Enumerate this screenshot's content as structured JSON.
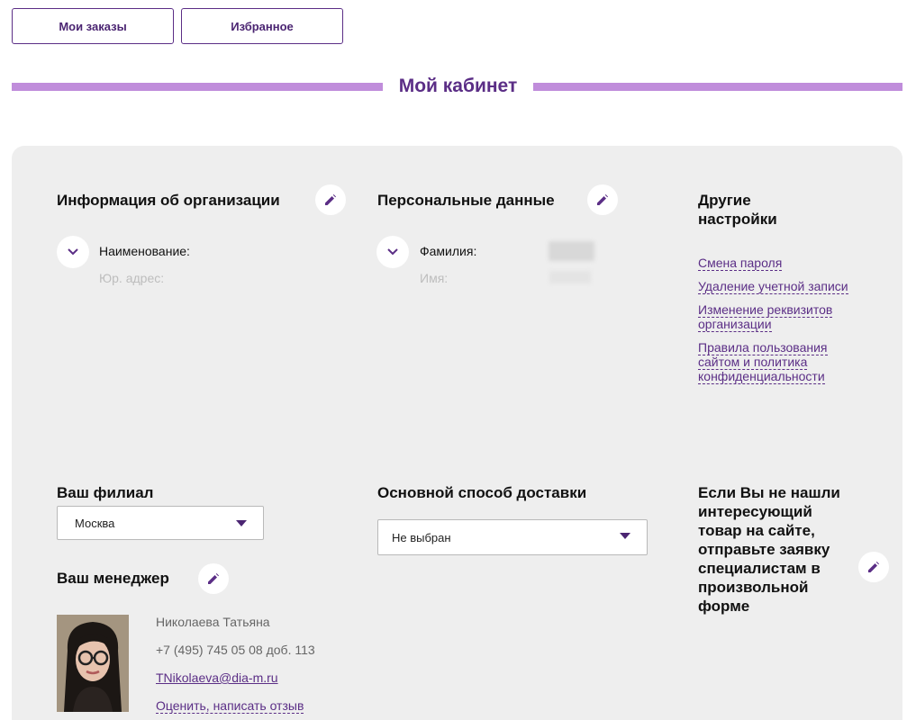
{
  "top_nav": {
    "orders_label": "Мои заказы",
    "favorites_label": "Избранное"
  },
  "page": {
    "title": "Мой кабинет"
  },
  "organization": {
    "title": "Информация об организации",
    "name_label": "Наименование:",
    "address_label": "Юр. адрес:"
  },
  "personal": {
    "title": "Персональные данные",
    "surname_label": "Фамилия:",
    "name_label": "Имя:"
  },
  "other_settings": {
    "title_line1": "Другие",
    "title_line2": "настройки",
    "links": [
      {
        "label": "Смена пароля"
      },
      {
        "label": "Удаление учетной записи"
      },
      {
        "label": "Изменение реквизитов организации"
      },
      {
        "label": "Правила пользования сайтом и политика конфиденциальности"
      }
    ]
  },
  "branch": {
    "title": "Ваш филиал",
    "selected": "Москва"
  },
  "delivery": {
    "title": "Основной способ доставки",
    "selected": "Не выбран"
  },
  "manager": {
    "title": "Ваш менеджер",
    "name": "Николаева Татьяна",
    "phone": "+7 (495) 745 05 08 доб. 113",
    "email": "TNikolaeva@dia-m.ru",
    "rate_label": "Оценить, написать отзыв"
  },
  "request": {
    "text": "Если Вы не нашли интересующий товар на сайте, отправьте заявку специалистам в произвольной форме"
  },
  "colors": {
    "accent": "#5b2e86",
    "bar": "#c08ddb",
    "panel": "#eeeeee"
  },
  "icons": {
    "edit": "pencil-icon",
    "expand": "chevron-down-icon",
    "dropdown": "caret-down-icon"
  }
}
